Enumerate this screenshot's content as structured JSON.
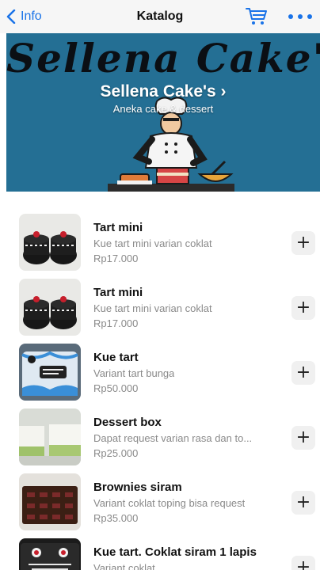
{
  "navbar": {
    "back_label": "Info",
    "title": "Katalog",
    "cart_icon": "cart-icon",
    "more_icon": "more-icon",
    "accent_color": "#1a73e8"
  },
  "banner": {
    "script_text": "Sellena Cake's",
    "store_name": "Sellena Cake's",
    "chevron": "›",
    "subtitle": "Aneka cake & dessert",
    "background_color": "#246f94"
  },
  "products": [
    {
      "name": "Tart mini",
      "description": "Kue tart mini varian coklat",
      "price": "Rp17.000",
      "add_label": "+"
    },
    {
      "name": "Tart mini",
      "description": "Kue tart mini varian coklat",
      "price": "Rp17.000",
      "add_label": "+"
    },
    {
      "name": "Kue tart",
      "description": "Variant tart bunga",
      "price": "Rp50.000",
      "add_label": "+"
    },
    {
      "name": "Dessert box",
      "description": "Dapat request varian rasa dan to...",
      "price": "Rp25.000",
      "add_label": "+"
    },
    {
      "name": "Brownies siram",
      "description": "Variant coklat toping bisa request",
      "price": "Rp35.000",
      "add_label": "+"
    },
    {
      "name": "Kue tart. Coklat siram 1 lapis",
      "description": "Variant coklat",
      "price": "",
      "add_label": "+"
    }
  ]
}
